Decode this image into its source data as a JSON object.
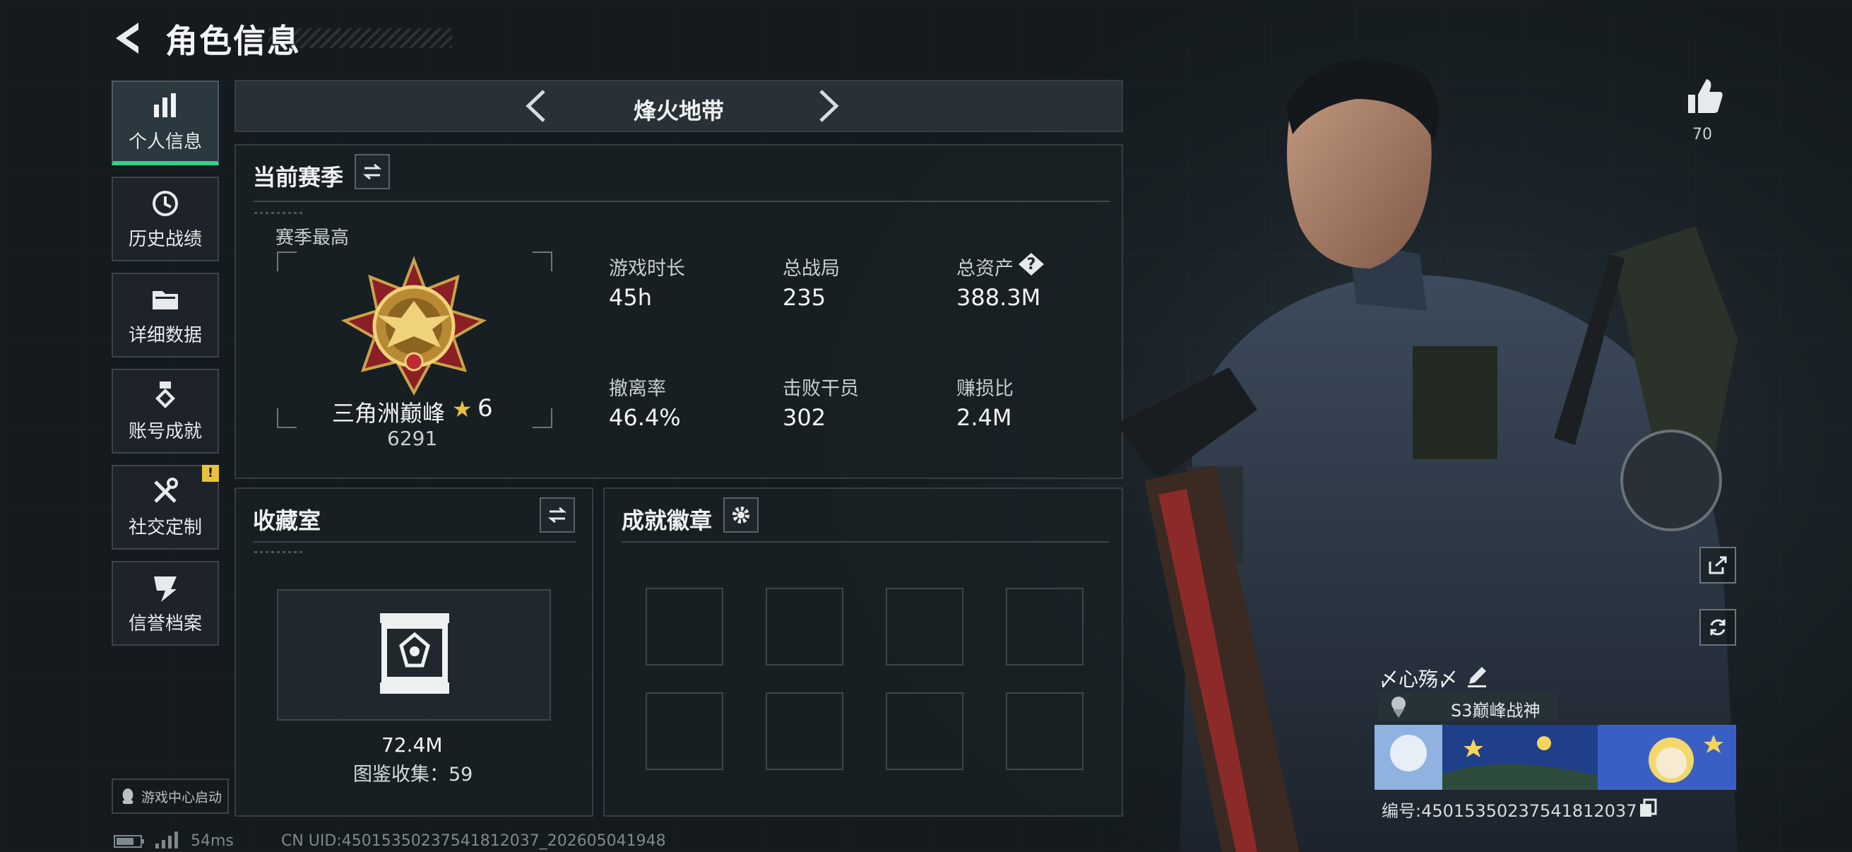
{
  "header": {
    "title": "角色信息"
  },
  "sidebar": {
    "items": [
      {
        "label": "个人信息",
        "icon": "bar-chart-icon",
        "active": true
      },
      {
        "label": "历史战绩",
        "icon": "history-clock-icon"
      },
      {
        "label": "详细数据",
        "icon": "folder-icon"
      },
      {
        "label": "账号成就",
        "icon": "medal-icon"
      },
      {
        "label": "社交定制",
        "icon": "tools-icon",
        "badge": "!"
      },
      {
        "label": "信誉档案",
        "icon": "reputation-icon"
      }
    ],
    "game_center": "游戏中心启动"
  },
  "mode": {
    "title": "烽火地带"
  },
  "season": {
    "title": "当前赛季",
    "best_label": "赛季最高",
    "rank_name": "三角洲巅峰",
    "rank_level": "6",
    "rank_points": "6291",
    "stats": [
      {
        "label": "游戏时长",
        "value": "45h"
      },
      {
        "label": "总战局",
        "value": "235"
      },
      {
        "label": "总资产",
        "value": "388.3M"
      },
      {
        "label": "撤离率",
        "value": "46.4%"
      },
      {
        "label": "击败干员",
        "value": "302"
      },
      {
        "label": "赚损比",
        "value": "2.4M"
      }
    ]
  },
  "collection": {
    "title": "收藏室",
    "value": "72.4M",
    "count_text": "图鉴收集：59"
  },
  "achievements": {
    "title": "成就徽章"
  },
  "character": {
    "likes": "70",
    "nickname": "〆心殇〆",
    "title": "S3巅峰战神",
    "uid_text": "编号:45015350237541812037"
  },
  "footer": {
    "ping": "54ms",
    "uid": "CN UID:45015350237541812037_202605041948"
  },
  "colors": {
    "accent": "#2fd38a",
    "gold": "#e7c23b",
    "background": "#141a1d"
  }
}
